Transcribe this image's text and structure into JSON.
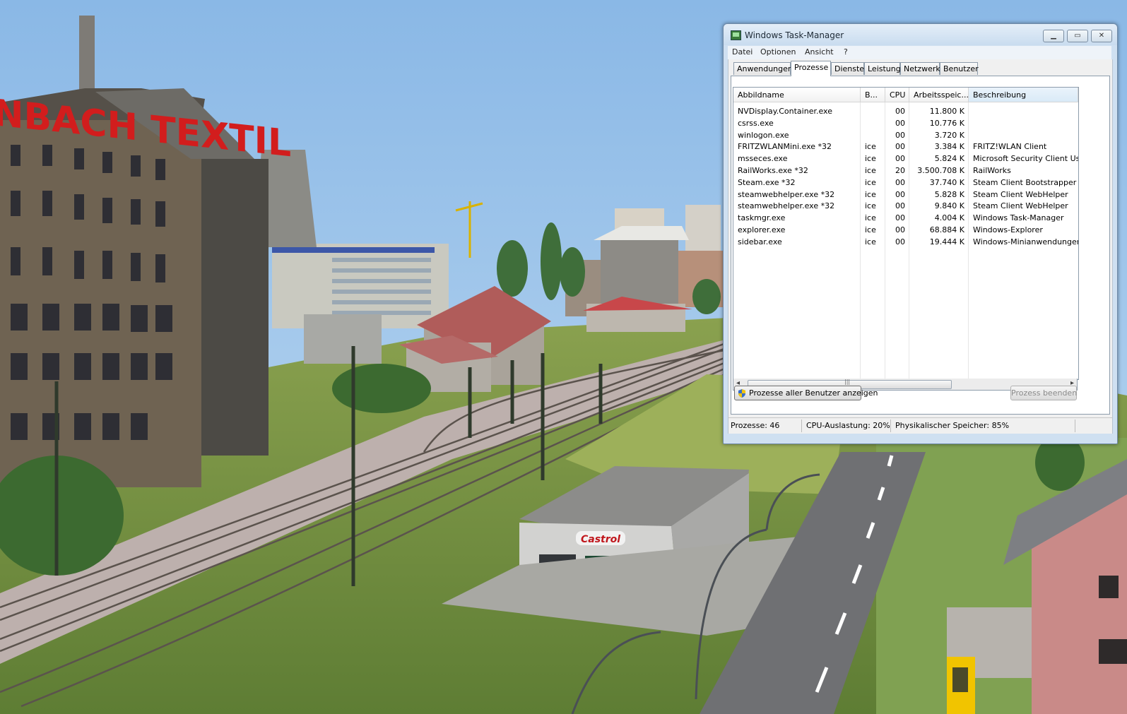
{
  "window": {
    "title": "Windows Task-Manager",
    "buttons": {
      "minimize": "▁",
      "maximize": "▭",
      "close": "✕"
    }
  },
  "menu": [
    "Datei",
    "Optionen",
    "Ansicht",
    "?"
  ],
  "tabs": [
    {
      "label": "Anwendungen",
      "active": false
    },
    {
      "label": "Prozesse",
      "active": true
    },
    {
      "label": "Dienste",
      "active": false
    },
    {
      "label": "Leistung",
      "active": false
    },
    {
      "label": "Netzwerk",
      "active": false
    },
    {
      "label": "Benutzer",
      "active": false
    }
  ],
  "columns": [
    "Abbildname",
    "B...",
    "CPU",
    "Arbeitsspeic...",
    "Beschreibung"
  ],
  "processes": [
    {
      "name": "NVDisplay.Container.exe",
      "user": "",
      "cpu": "00",
      "mem": "11.800 K",
      "desc": ""
    },
    {
      "name": "csrss.exe",
      "user": "",
      "cpu": "00",
      "mem": "10.776 K",
      "desc": ""
    },
    {
      "name": "winlogon.exe",
      "user": "",
      "cpu": "00",
      "mem": "3.720 K",
      "desc": ""
    },
    {
      "name": "FRITZWLANMini.exe *32",
      "user": "ice",
      "cpu": "00",
      "mem": "3.384 K",
      "desc": "FRITZ!WLAN Client"
    },
    {
      "name": "msseces.exe",
      "user": "ice",
      "cpu": "00",
      "mem": "5.824 K",
      "desc": "Microsoft Security Client User Int"
    },
    {
      "name": "RailWorks.exe *32",
      "user": "ice",
      "cpu": "20",
      "mem": "3.500.708 K",
      "desc": "RailWorks"
    },
    {
      "name": "Steam.exe *32",
      "user": "ice",
      "cpu": "00",
      "mem": "37.740 K",
      "desc": "Steam Client Bootstrapper"
    },
    {
      "name": "steamwebhelper.exe *32",
      "user": "ice",
      "cpu": "00",
      "mem": "5.828 K",
      "desc": "Steam Client WebHelper"
    },
    {
      "name": "steamwebhelper.exe *32",
      "user": "ice",
      "cpu": "00",
      "mem": "9.840 K",
      "desc": "Steam Client WebHelper"
    },
    {
      "name": "taskmgr.exe",
      "user": "ice",
      "cpu": "00",
      "mem": "4.004 K",
      "desc": "Windows Task-Manager"
    },
    {
      "name": "explorer.exe",
      "user": "ice",
      "cpu": "00",
      "mem": "68.884 K",
      "desc": "Windows-Explorer"
    },
    {
      "name": "sidebar.exe",
      "user": "ice",
      "cpu": "00",
      "mem": "19.444 K",
      "desc": "Windows-Minianwendungen"
    }
  ],
  "scrollbar": {
    "left_arrow": "◂",
    "right_arrow": "▸",
    "grip": "|||"
  },
  "buttons": {
    "show_all": "Prozesse aller Benutzer anzeigen",
    "end_process": "Prozess beenden"
  },
  "status": {
    "processes": "Prozesse: 46",
    "cpu": "CPU-Auslastung: 20%",
    "memory": "Physikalischer Speicher: 85%"
  },
  "scene": {
    "factory_sign": "NBACH TEXTIL",
    "garage_sign": "Castrol"
  }
}
